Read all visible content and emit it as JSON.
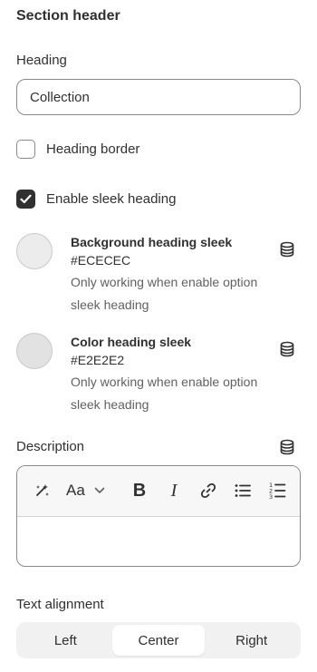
{
  "section_title": "Section header",
  "heading": {
    "label": "Heading",
    "value": "Collection"
  },
  "heading_border": {
    "label": "Heading border",
    "checked": false
  },
  "sleek_heading": {
    "label": "Enable sleek heading",
    "checked": true
  },
  "colors": [
    {
      "title": "Background heading sleek",
      "hex": "#ECECEC",
      "help_line1": "Only working when enable option",
      "help_line2": "sleek heading",
      "icon": "database-icon"
    },
    {
      "title": "Color heading sleek",
      "hex": "#E2E2E2",
      "help_line1": "Only working when enable option",
      "help_line2": "sleek heading",
      "icon": "database-icon"
    }
  ],
  "description": {
    "label": "Description",
    "icon": "database-icon",
    "toolbar": [
      "magic-icon",
      "text-style-icon",
      "bold-icon",
      "italic-icon",
      "link-icon",
      "bullet-list-icon",
      "numbered-list-icon"
    ],
    "text_style_label": "Aa",
    "bold_label": "B",
    "italic_label": "I",
    "value": ""
  },
  "text_alignment": {
    "label": "Text alignment",
    "options": [
      "Left",
      "Center",
      "Right"
    ],
    "selected": "Center"
  }
}
